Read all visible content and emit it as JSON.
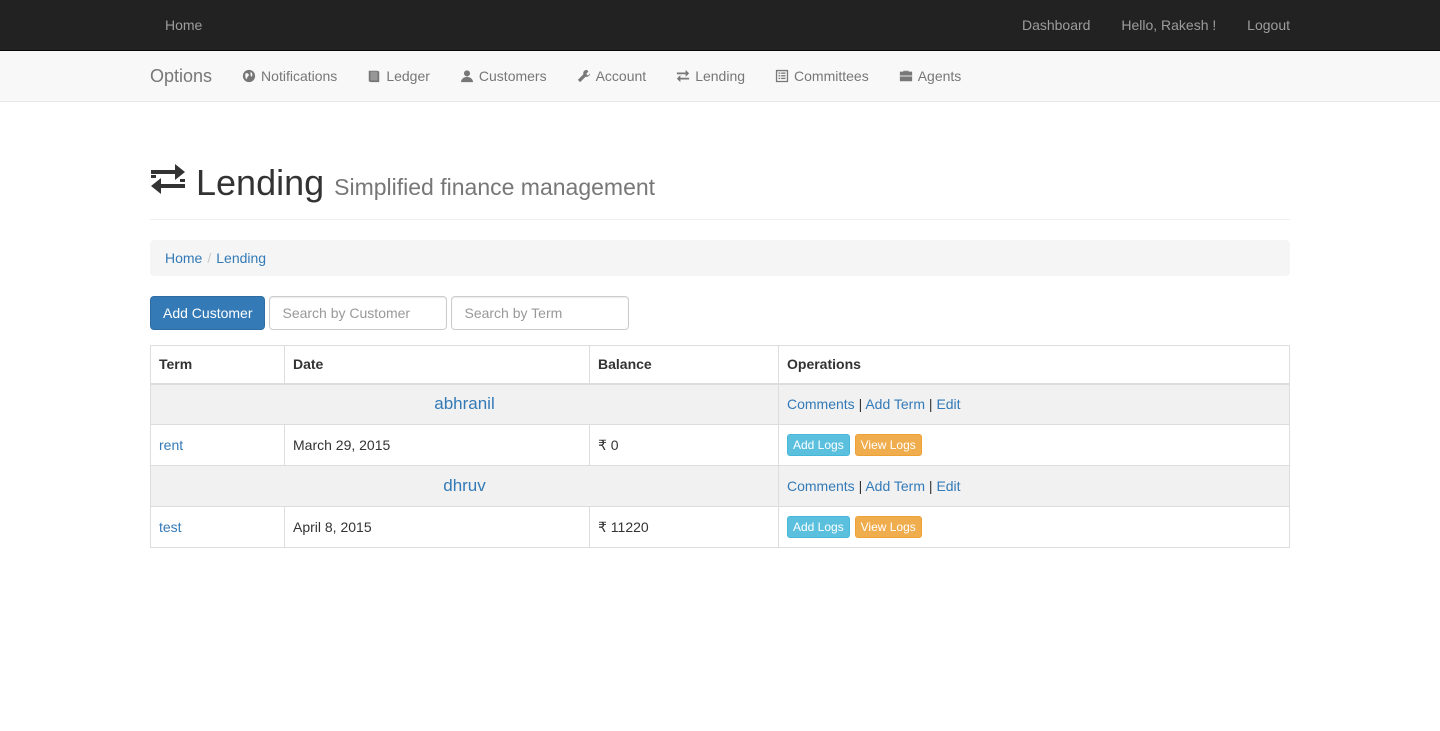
{
  "topnav": {
    "home": "Home",
    "dashboard": "Dashboard",
    "greeting": "Hello, Rakesh !",
    "logout": "Logout"
  },
  "subnav": {
    "brand": "Options",
    "items": [
      {
        "label": "Notifications",
        "icon": "globe-icon"
      },
      {
        "label": "Ledger",
        "icon": "book-icon"
      },
      {
        "label": "Customers",
        "icon": "user-icon"
      },
      {
        "label": "Account",
        "icon": "wrench-icon"
      },
      {
        "label": "Lending",
        "icon": "transfer-icon"
      },
      {
        "label": "Committees",
        "icon": "list-alt-icon"
      },
      {
        "label": "Agents",
        "icon": "briefcase-icon"
      }
    ]
  },
  "header": {
    "icon": "transfer-icon",
    "title": "Lending",
    "subtitle": "Simplified finance management"
  },
  "breadcrumb": [
    "Home",
    "Lending"
  ],
  "toolbar": {
    "add_customer": "Add Customer",
    "search_customer_placeholder": "Search by Customer",
    "search_term_placeholder": "Search by Term"
  },
  "table": {
    "headers": [
      "Term",
      "Date",
      "Balance",
      "Operations"
    ],
    "ops": {
      "comments": "Comments",
      "add_term": "Add Term",
      "edit": "Edit",
      "sep": "|"
    },
    "row_buttons": {
      "add_logs": "Add Logs",
      "view_logs": "View Logs"
    },
    "groups": [
      {
        "customer": "abhranil",
        "terms": [
          {
            "term": "rent",
            "date": "March 29, 2015",
            "balance": "₹ 0"
          }
        ]
      },
      {
        "customer": "dhruv",
        "terms": [
          {
            "term": "test",
            "date": "April 8, 2015",
            "balance": "₹ 11220"
          }
        ]
      }
    ]
  },
  "colors": {
    "navbar_dark": "#222222",
    "primary": "#337ab7",
    "info": "#5bc0de",
    "warning": "#f0ad4e"
  }
}
